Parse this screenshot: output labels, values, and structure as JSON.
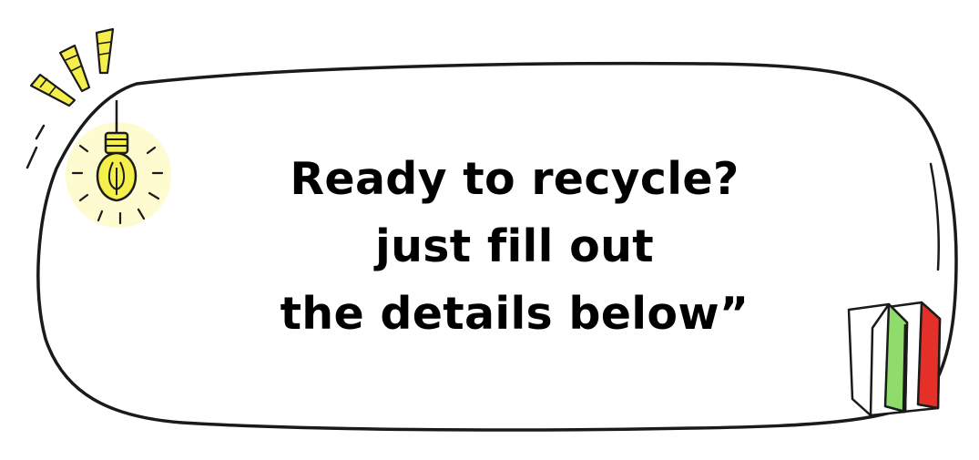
{
  "message": {
    "lines": [
      "Ready to recycle?",
      "just fill out",
      "the details below”"
    ]
  },
  "colors": {
    "text": "#000000",
    "outline": "#1a1a1a",
    "bulb": "#f4ef4a",
    "bulb_glow": "#fbf7a8",
    "book_green": "#8fdc6a",
    "book_red": "#e5302a"
  },
  "icons": [
    "light-bulb-icon",
    "books-icon"
  ]
}
